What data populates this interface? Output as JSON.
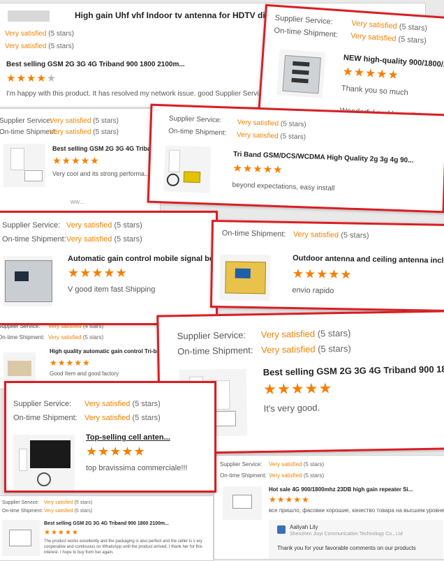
{
  "labels": {
    "supplier": "Supplier Service:",
    "ontime": "On-time Shipment:",
    "very_satisfied": "Very satisfied",
    "five_stars": "(5 stars)",
    "four_stars": "(4 stars)"
  },
  "colors": {
    "frame": "#d91e24",
    "rating": "#f08200",
    "star": "#f77f00"
  },
  "cards": {
    "c1": {
      "header": "High gain Uhf vhf Indoor tv antenna for HDTV digital t...",
      "title": "Best selling GSM 2G 3G 4G Triband 900 1800 2100m...",
      "rating": 4,
      "review": "I'm happy with this product. It has resolved my network issue. good Supplier Servi..."
    },
    "c2": {
      "title": "NEW high-quality 900/1800/...",
      "rating": 5,
      "review": "Thank you so much",
      "review2": "Wonderful and beautiful"
    },
    "c3": {
      "title": "Best selling GSM 2G 3G 4G Triba...",
      "rating": 5,
      "review": "Very cool and its strong performa...",
      "footer": "ww..."
    },
    "c4": {
      "title": "Tri Band GSM/DCS/WCDMA High Quality 2g 3g 4g 90...",
      "rating": 5,
      "review": "beyond expectations, easy install"
    },
    "c5": {
      "title": "Automatic gain control mobile signal booster...",
      "rating": 5,
      "review": "V good item fast Shipping"
    },
    "c6": {
      "title": "Outdoor antenna and ceiling antenna incl...",
      "rating": 5,
      "review": "envio rapido"
    },
    "c7": {
      "title": "High quality automatic gain control Tri-ban...",
      "rating": 5,
      "review": "Good Item and good factory"
    },
    "c8": {
      "title": "Best selling GSM 2G 3G 4G Triband 900 1800 ...",
      "rating": 5,
      "review": "It's very good."
    },
    "c9": {
      "title": "Top-selling cell anten...",
      "rating": 5,
      "review": "top bravissima commerciale!!!"
    },
    "c10": {
      "title": "Hot sale 4G 900/1800mhz 23DB high gain repeater Si...",
      "rating": 5,
      "review": "все пришло, фасовки хорошие, качество товара на высшем уровне.",
      "replier_name": "Aaliyah Lily",
      "replier_company": "Shenzhen Jiuyi Communication Technology Co., Ltd",
      "reply": "Thank you for your favorable comments on our products"
    },
    "c11": {
      "title": "Best selling GSM 2G 3G 4G Triband 900 1800 2100m...",
      "rating": 5,
      "review": "The product works excellently and the packaging is also perfect and the seller is v ery cooperative and continuous on WhatsApp until the product arrived. I thank her for this interest. I hope to buy from her again."
    }
  }
}
